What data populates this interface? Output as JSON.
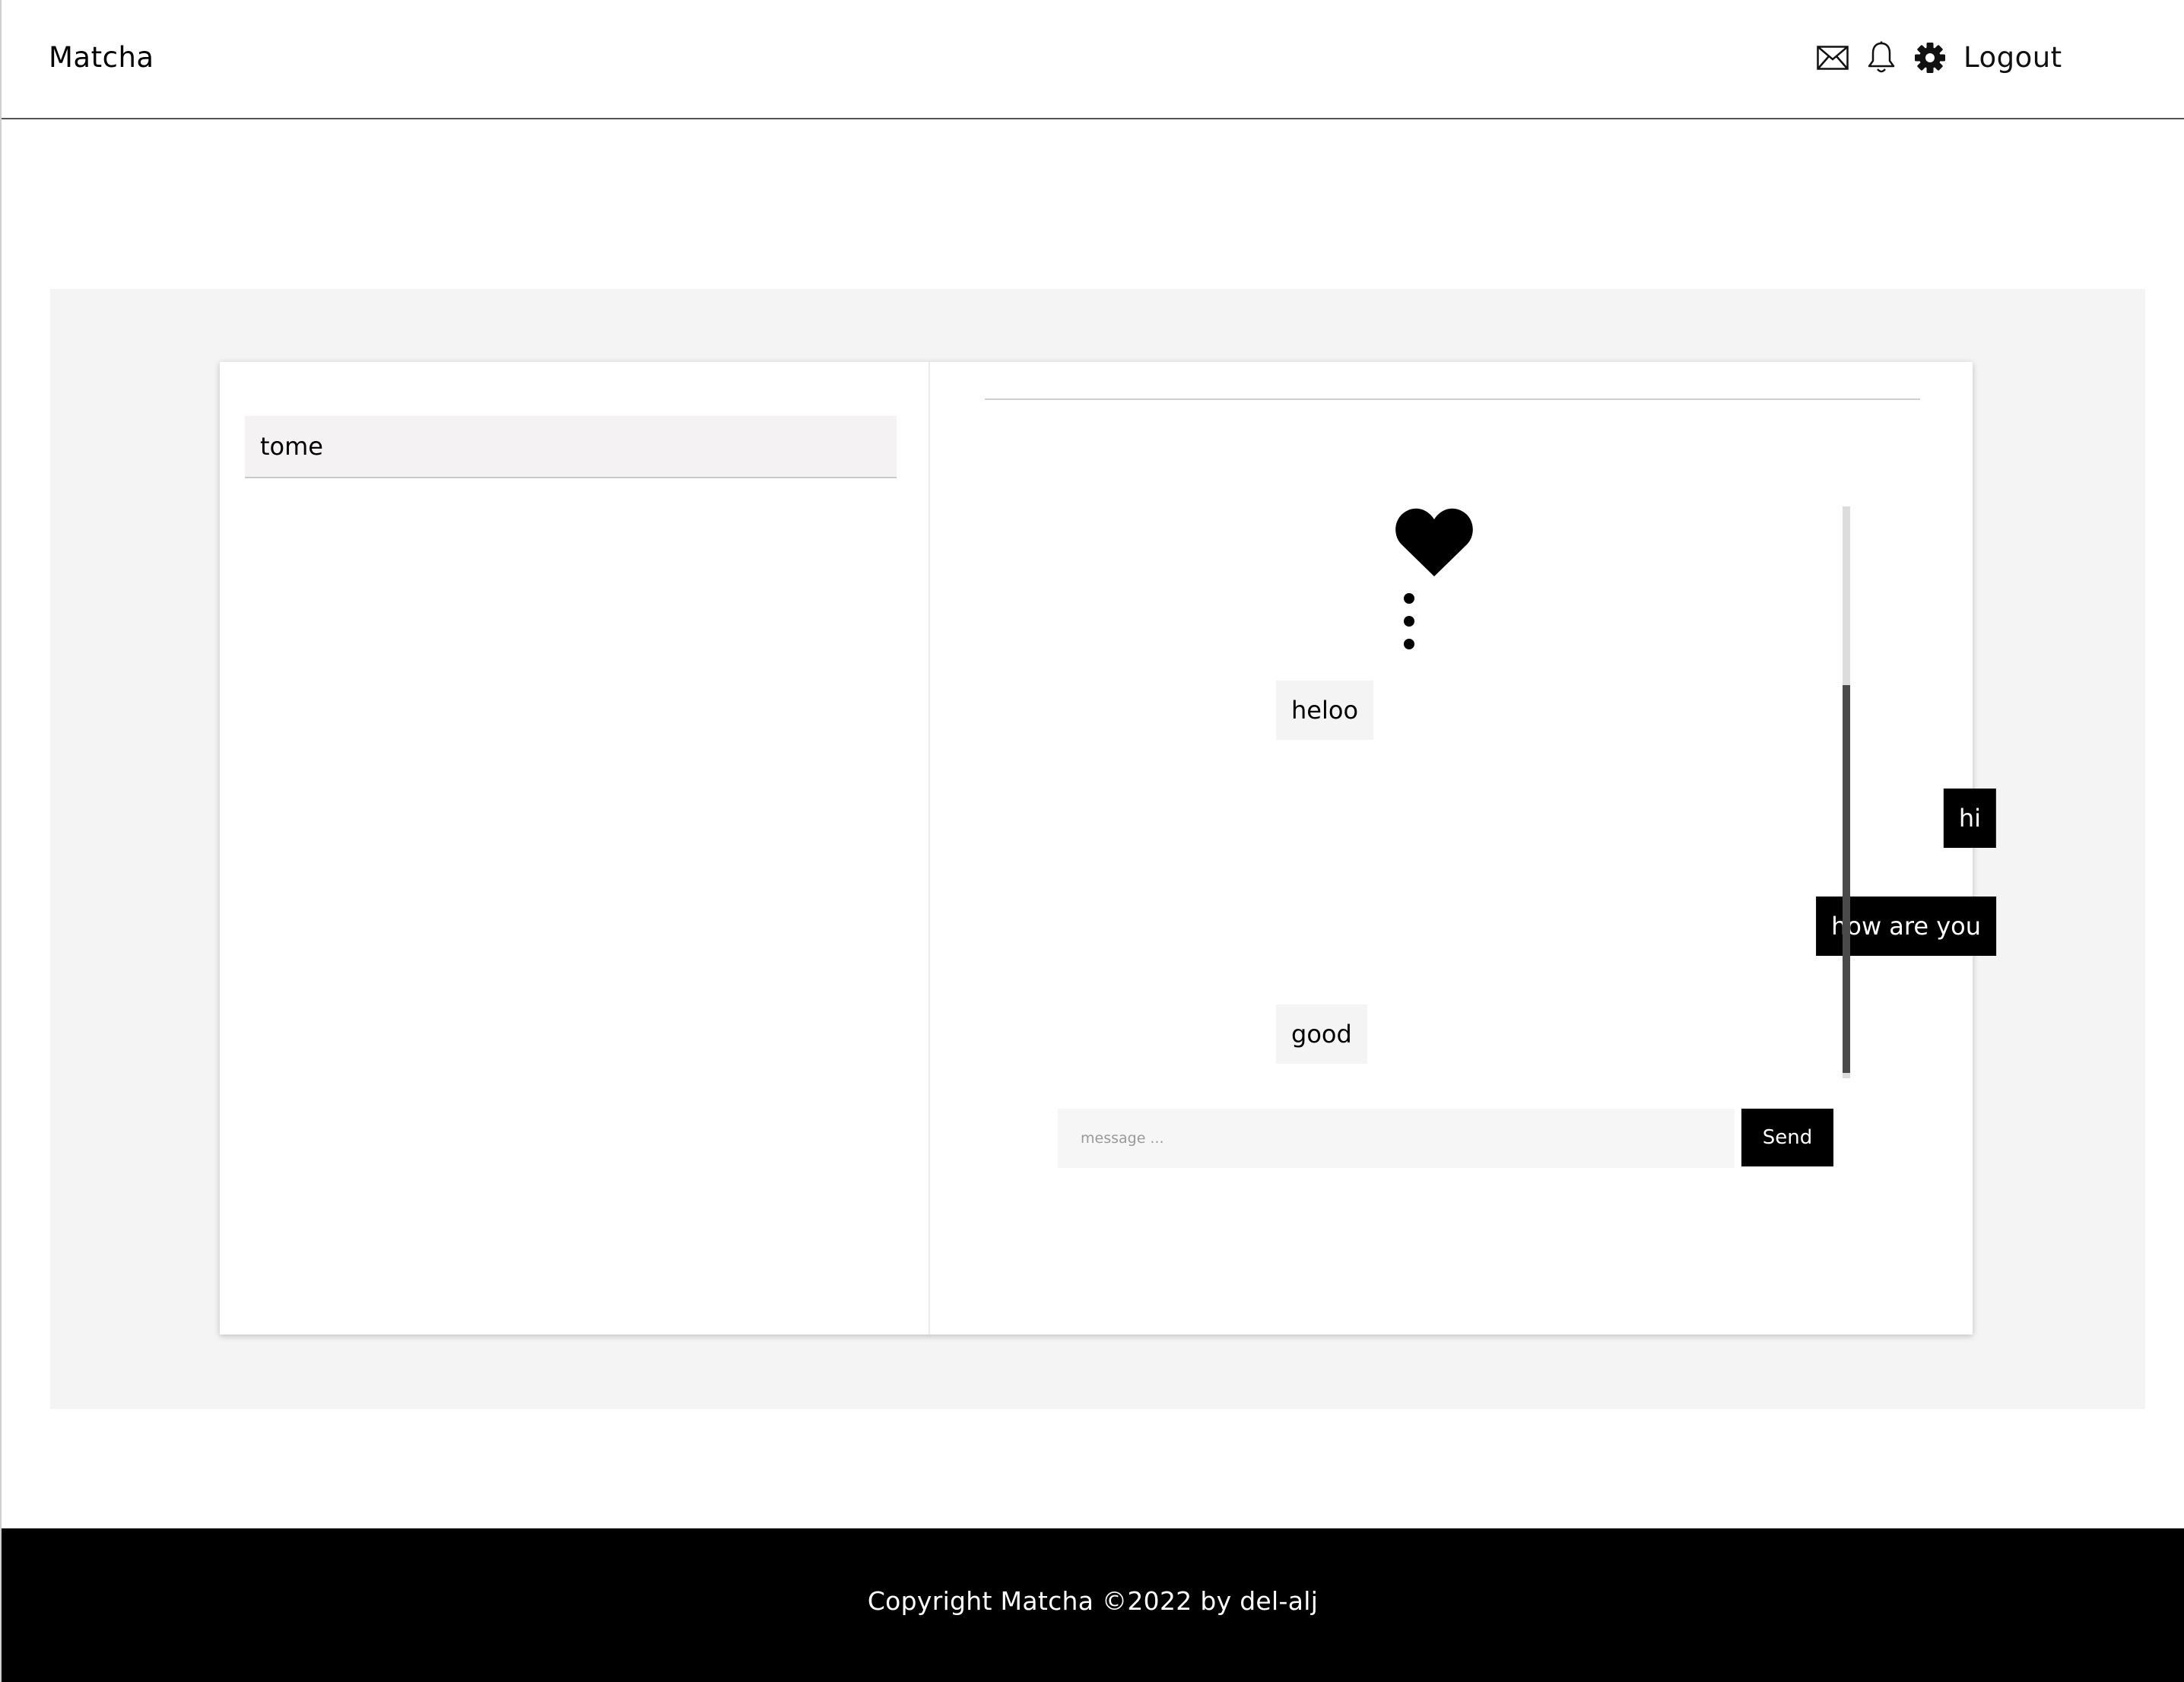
{
  "header": {
    "brand": "Matcha",
    "icons": [
      "envelope-icon",
      "bell-icon",
      "gear-icon"
    ],
    "logout_label": "Logout"
  },
  "contacts": [
    {
      "name": "tome"
    }
  ],
  "chat": {
    "match_icon": "heart-icon",
    "menu_icon": "vertical-dots-icon",
    "messages": [
      {
        "text": "heloo",
        "direction": "incoming"
      },
      {
        "text": "hi",
        "direction": "outgoing"
      },
      {
        "text": "how are you",
        "direction": "outgoing"
      },
      {
        "text": "good",
        "direction": "incoming"
      }
    ],
    "input_placeholder": "message ...",
    "input_value": "",
    "send_label": "Send"
  },
  "footer": {
    "copyright": "Copyright Matcha ©2022 by del-alj"
  },
  "colors": {
    "accent": "#000000",
    "section_bg": "#f4f4f4",
    "incoming_bubble": "#f4f4f4",
    "outgoing_bubble": "#000000"
  }
}
